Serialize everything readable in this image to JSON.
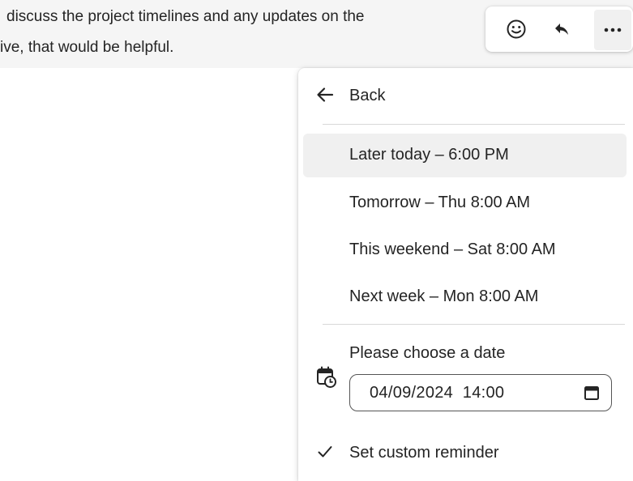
{
  "message": {
    "line1": "discuss the project timelines and any updates on the",
    "line2": "ive, that would be helpful."
  },
  "toolbar": {
    "emoji_icon": "smiley-icon",
    "reply_icon": "reply-arrow-icon",
    "more_icon": "more-ellipsis-icon",
    "more_label": "···"
  },
  "menu": {
    "back_label": "Back",
    "options": [
      {
        "label": "Later today – 6:00 PM"
      },
      {
        "label": "Tomorrow – Thu 8:00 AM"
      },
      {
        "label": "This weekend – Sat 8:00 AM"
      },
      {
        "label": "Next week – Mon 8:00 AM"
      }
    ],
    "choose_date_label": "Please choose a date",
    "date_value": "04/09/2024  14:00",
    "custom_reminder_label": "Set custom reminder"
  },
  "colors": {
    "text": "#242424",
    "highlight": "#f0f0f0",
    "message_bg": "#f5f5f5"
  }
}
